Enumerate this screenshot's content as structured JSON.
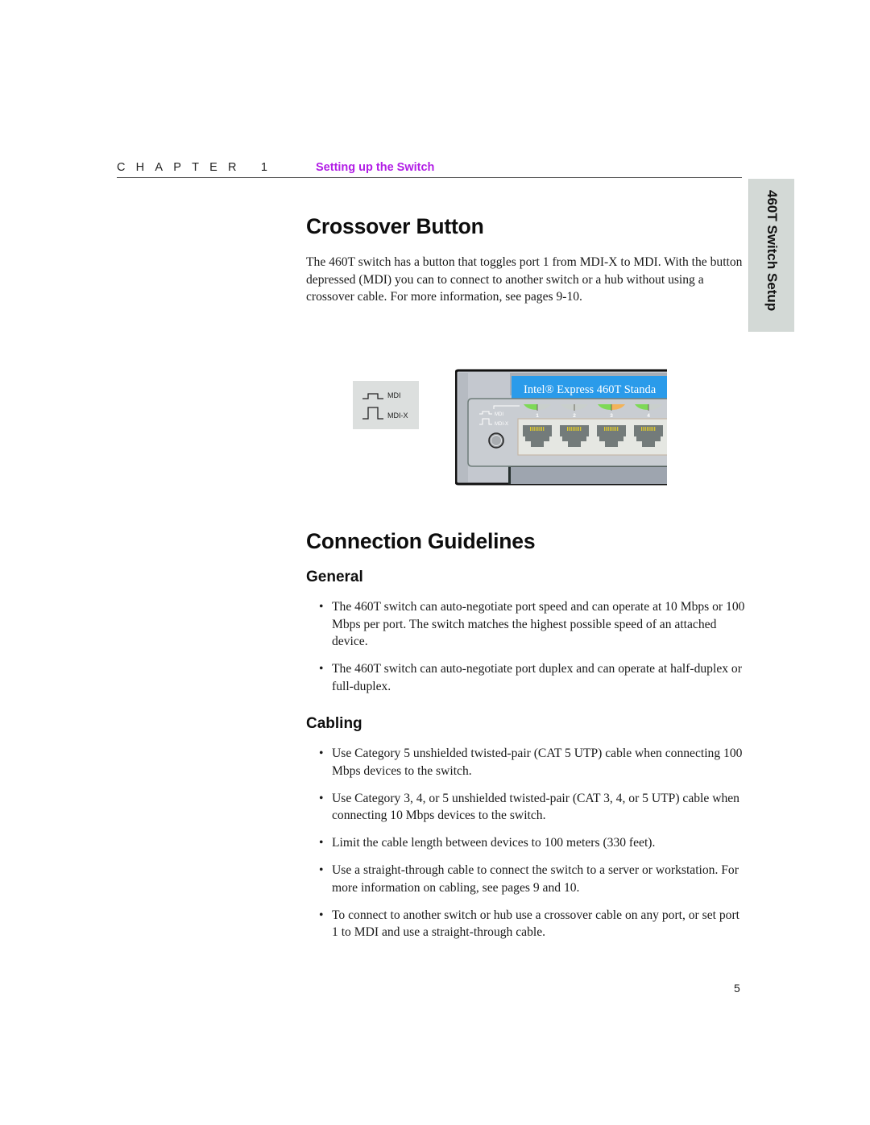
{
  "header": {
    "chapter_label": "CHAPTER 1",
    "chapter_title": "Setting up the Switch"
  },
  "side_tab": {
    "label": "460T Switch Setup"
  },
  "crossover": {
    "heading": "Crossover Button",
    "paragraph": "The 460T switch has a button that toggles port 1 from MDI-X to MDI. With the button depressed (MDI) you can to connect to another switch or a hub without using a crossover cable. For more information, see pages 9-10."
  },
  "figure": {
    "legend": [
      {
        "icon": "button-depressed-icon",
        "label": "MDI"
      },
      {
        "icon": "button-raised-icon",
        "label": "MDI-X"
      }
    ],
    "switch": {
      "brand_label": "Intel® Express 460T Standa",
      "panel_mdi_label": "MDI",
      "panel_mdix_label": "MDI-X",
      "ports": [
        {
          "number": "1",
          "led_left": "#7ed957",
          "led_right": "#c9cfcc"
        },
        {
          "number": "2",
          "led_left": "#c9cfcc",
          "led_right": "#c9cfcc"
        },
        {
          "number": "3",
          "led_left": "#7ed957",
          "led_right": "#f2b35a"
        },
        {
          "number": "4",
          "led_left": "#7ed957",
          "led_right": "#c9cfcc"
        }
      ],
      "colors": {
        "brand_bg": "#2a9bea",
        "chassis": "#c4c8cf",
        "body": "#9ea5af",
        "port": "#737b7a",
        "pins": "#e1cb2c"
      }
    }
  },
  "guidelines": {
    "heading": "Connection Guidelines",
    "general": {
      "heading": "General",
      "bullets": [
        "The 460T switch can auto-negotiate port speed and can operate at 10 Mbps or 100 Mbps per port. The switch matches the highest possible speed of an attached device.",
        "The 460T switch can auto-negotiate port duplex and can operate at half-duplex or full-duplex."
      ]
    },
    "cabling": {
      "heading": "Cabling",
      "bullets": [
        "Use Category 5 unshielded twisted-pair (CAT 5 UTP) cable when connecting 100 Mbps devices to the switch.",
        "Use Category 3, 4, or 5 unshielded twisted-pair (CAT 3, 4, or 5 UTP) cable when connecting 10 Mbps devices to the switch.",
        "Limit the cable length between devices to 100 meters (330 feet).",
        "Use a straight-through cable to connect the switch to a server or workstation. For more information on cabling, see pages 9 and 10.",
        "To connect to another switch or hub use a crossover cable on any port, or set port 1 to MDI and use a straight-through cable."
      ]
    }
  },
  "footer": {
    "page_number": "5"
  }
}
